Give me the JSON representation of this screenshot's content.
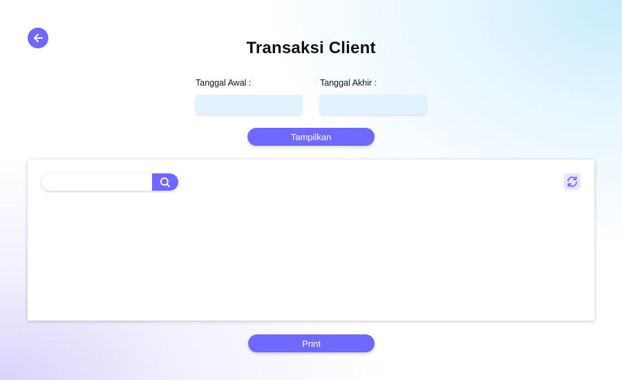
{
  "header": {
    "title": "Transaksi Client",
    "back_icon": "arrow-left-icon"
  },
  "filters": {
    "start_label": "Tanggal Awal :",
    "start_value": "",
    "end_label": "Tanggal Akhir :",
    "end_value": "",
    "show_button_label": "Tampilkan"
  },
  "table_panel": {
    "search_value": "",
    "search_icon": "search-icon",
    "refresh_icon": "refresh-icon"
  },
  "footer": {
    "print_button_label": "Print"
  },
  "colors": {
    "accent": "#7068fb",
    "input_bg": "#e3f3fe",
    "refresh_bg": "#e7e5fd"
  }
}
